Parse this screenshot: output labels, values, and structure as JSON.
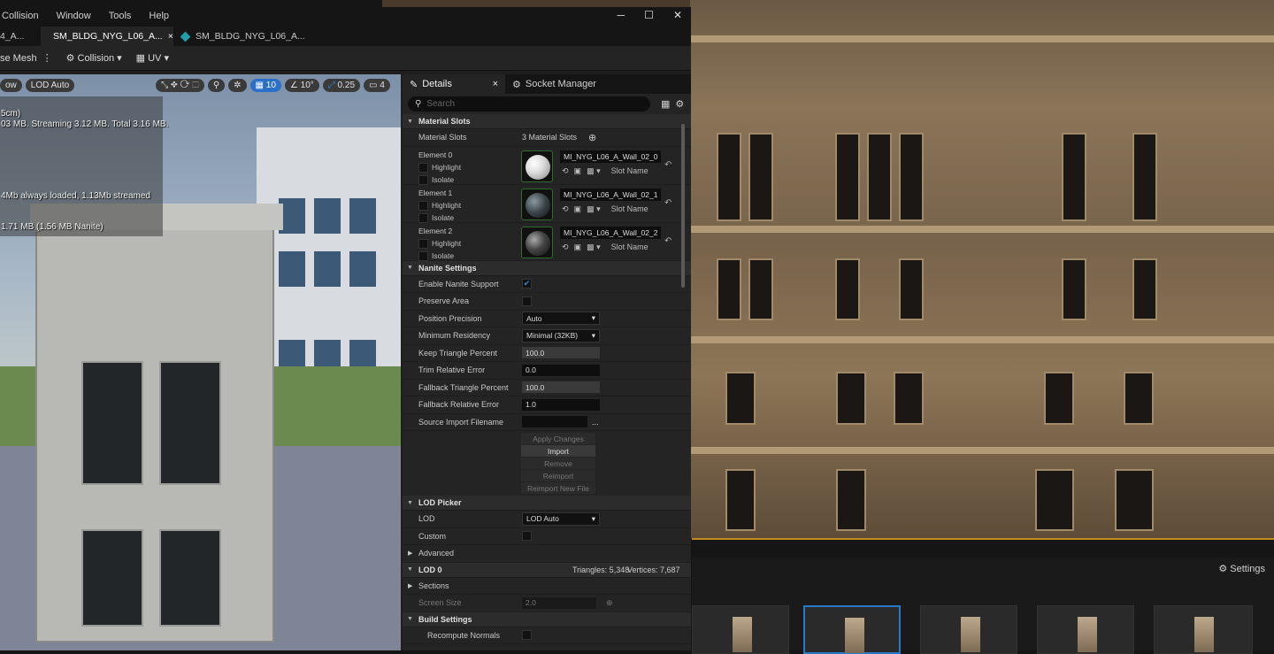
{
  "window": {
    "menu": [
      "Collision",
      "Window",
      "Tools",
      "Help"
    ],
    "tabs": [
      {
        "label": "4_A..."
      },
      {
        "label": "SM_BLDG_NYG_L06_A...",
        "close": "×"
      },
      {
        "label": "SM_BLDG_NYG_L06_A..."
      }
    ],
    "controls": {
      "minimize": "─",
      "maximize": "☐",
      "close": "✕"
    }
  },
  "toolbar": {
    "mesh": "se Mesh",
    "more": "⋮",
    "collision": "Collision",
    "uv": "UV"
  },
  "viewport": {
    "pill_left": "ow",
    "lod": "LOD Auto",
    "grid": "10",
    "angle": "10°",
    "scale": "0.25",
    "camera": "4",
    "stats": [
      "5cm)",
      "03 MB. Streaming 3.12 MB. Total 3.16 MB.",
      "4Mb always loaded, 1.13Mb streamed",
      "1.71 MB (1.56 MB Nanite)"
    ]
  },
  "details": {
    "tab_details": "Details",
    "tab_close": "×",
    "tab_socket": "Socket Manager",
    "search_placeholder": "Search",
    "material_slots": {
      "title": "Material Slots",
      "label": "Material Slots",
      "count": "3 Material Slots",
      "elements": [
        {
          "name": "Element 0",
          "material": "MI_NYG_L06_A_Wall_02_0",
          "highlight": "Highlight",
          "isolate": "Isolate",
          "slot": "Slot Name"
        },
        {
          "name": "Element 1",
          "material": "MI_NYG_L06_A_Wall_02_1",
          "highlight": "Highlight",
          "isolate": "Isolate",
          "slot": "Slot Name"
        },
        {
          "name": "Element 2",
          "material": "MI_NYG_L06_A_Wall_02_2",
          "highlight": "Highlight",
          "isolate": "Isolate",
          "slot": "Slot Name"
        }
      ]
    },
    "nanite": {
      "title": "Nanite Settings",
      "enable": "Enable Nanite Support",
      "preserve": "Preserve Area",
      "position_precision": "Position Precision",
      "position_precision_value": "Auto",
      "min_residency": "Minimum Residency",
      "min_residency_value": "Minimal (32KB)",
      "keep_triangle": "Keep Triangle Percent",
      "keep_triangle_value": "100.0",
      "trim_error": "Trim Relative Error",
      "trim_error_value": "0.0",
      "fallback_triangle": "Fallback Triangle Percent",
      "fallback_triangle_value": "100.0",
      "fallback_error": "Fallback Relative Error",
      "fallback_error_value": "1.0",
      "source_import": "Source Import Filename",
      "source_more": "...",
      "buttons": [
        "Apply Changes",
        "Import",
        "Remove",
        "Reimport",
        "Reimport New File"
      ]
    },
    "lod_picker": {
      "title": "LOD Picker",
      "lod": "LOD",
      "lod_value": "LOD Auto",
      "custom": "Custom",
      "advanced": "Advanced"
    },
    "lod0": {
      "title": "LOD 0",
      "triangles": "Triangles: 5,348",
      "vertices": "Vertices: 7,687",
      "sections": "Sections",
      "screen_size": "Screen Size",
      "screen_size_value": "2.0"
    },
    "build": {
      "title": "Build Settings",
      "recompute": "Recompute Normals"
    }
  },
  "content_browser": {
    "settings": "Settings"
  }
}
